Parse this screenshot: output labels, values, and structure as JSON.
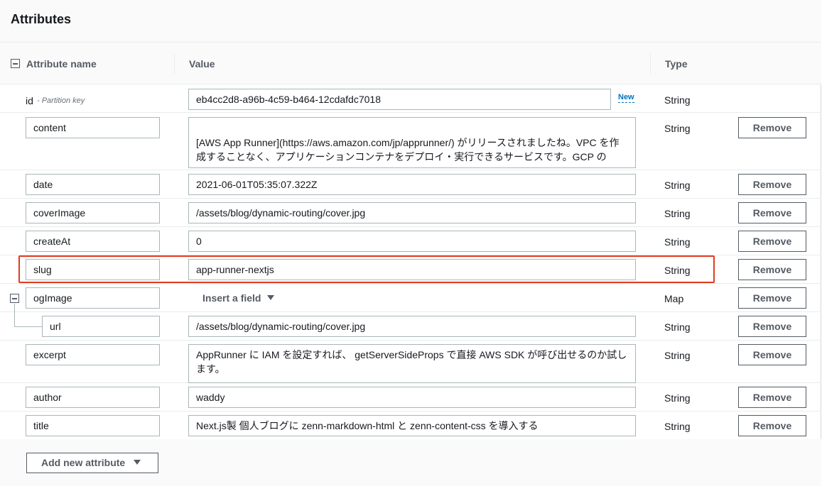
{
  "panel": {
    "title": "Attributes"
  },
  "columns": {
    "name": "Attribute name",
    "value": "Value",
    "type": "Type"
  },
  "id_row": {
    "name": "id",
    "partition_label": "- Partition key",
    "value": "eb4cc2d8-a96b-4c59-b464-12cdafdc7018",
    "new_label": "New",
    "type": "String"
  },
  "rows": [
    {
      "name": "content",
      "value": "[AWS App Runner](https://aws.amazon.com/jp/apprunner/) がリリースされましたね。VPC を作成することなく、アプリケーションコンテナをデプロイ・実行できるサービスです。GCP の",
      "type": "String",
      "remove": "Remove"
    },
    {
      "name": "date",
      "value": "2021-06-01T05:35:07.322Z",
      "type": "String",
      "remove": "Remove"
    },
    {
      "name": "coverImage",
      "value": "/assets/blog/dynamic-routing/cover.jpg",
      "type": "String",
      "remove": "Remove"
    },
    {
      "name": "createAt",
      "value": "0",
      "type": "String",
      "remove": "Remove"
    },
    {
      "name": "slug",
      "value": "app-runner-nextjs",
      "type": "String",
      "remove": "Remove"
    },
    {
      "name": "ogImage",
      "value": "Insert a field",
      "type": "Map",
      "remove": "Remove"
    },
    {
      "name": "url",
      "value": "/assets/blog/dynamic-routing/cover.jpg",
      "type": "String",
      "remove": "Remove"
    },
    {
      "name": "excerpt",
      "value": "AppRunner に IAM を設定すれば、 getServerSideProps で直接 AWS SDK が呼び出せるのか試します。",
      "type": "String",
      "remove": "Remove"
    },
    {
      "name": "author",
      "value": "waddy",
      "type": "String",
      "remove": "Remove"
    },
    {
      "name": "title",
      "value": "Next.js製 個人ブログに zenn-markdown-html と zenn-content-css を導入する",
      "type": "String",
      "remove": "Remove"
    }
  ],
  "footer": {
    "add_label": "Add new attribute"
  },
  "colors": {
    "highlight": "#e23b1f",
    "link": "#0073bb"
  }
}
